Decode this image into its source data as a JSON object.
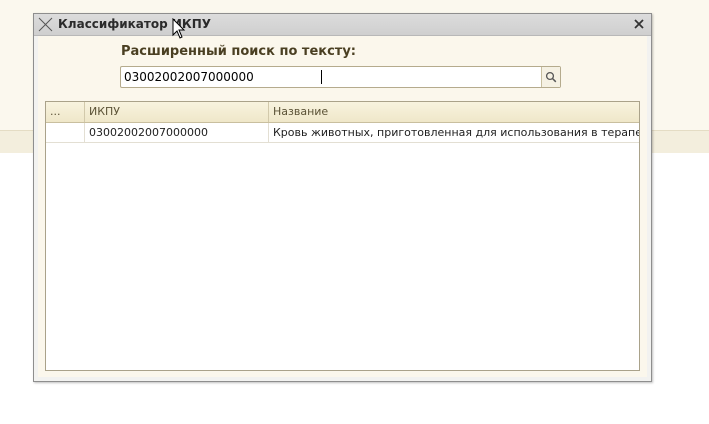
{
  "window": {
    "title": "Классификатор ИКПУ",
    "close_icon": "close-icon",
    "app_icon": "window-icon"
  },
  "search": {
    "label": "Расширенный поиск по тексту:",
    "value": "03002002007000000",
    "button_icon": "search-icon"
  },
  "table": {
    "columns": [
      "...",
      "ИКПУ",
      "Название"
    ],
    "rows": [
      {
        "marker": "",
        "code": "03002002007000000",
        "name": "Кровь животных, приготовленная для использования в терапевтиче..."
      }
    ]
  },
  "colors": {
    "header_bg": "#efe7c9",
    "dialog_bg": "#fbf7ec",
    "titlebar_bg": "#d6d6d6"
  }
}
